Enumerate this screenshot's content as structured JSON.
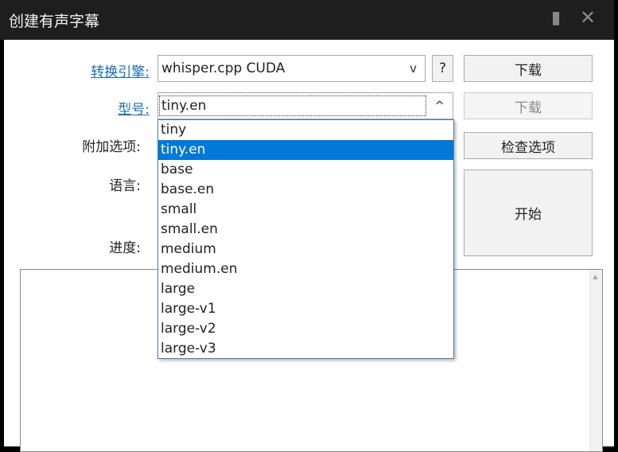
{
  "window": {
    "title": "创建有声字幕",
    "pin_icon": "pin-icon",
    "close_icon": "close-icon"
  },
  "engine": {
    "label": "转换引擎:",
    "value": "whisper.cpp CUDA",
    "arrow": "v",
    "help": "?",
    "download": "下载"
  },
  "model": {
    "label": "型号:",
    "value": "tiny.en",
    "arrow": "^",
    "download": "下载",
    "options": [
      "tiny",
      "tiny.en",
      "base",
      "base.en",
      "small",
      "small.en",
      "medium",
      "medium.en",
      "large",
      "large-v1",
      "large-v2",
      "large-v3"
    ],
    "selected_index": 1
  },
  "extra": {
    "label": "附加选项:",
    "check_button": "检查选项"
  },
  "language": {
    "label": "语言:"
  },
  "progress": {
    "label": "进度:"
  },
  "start_button": "开始"
}
